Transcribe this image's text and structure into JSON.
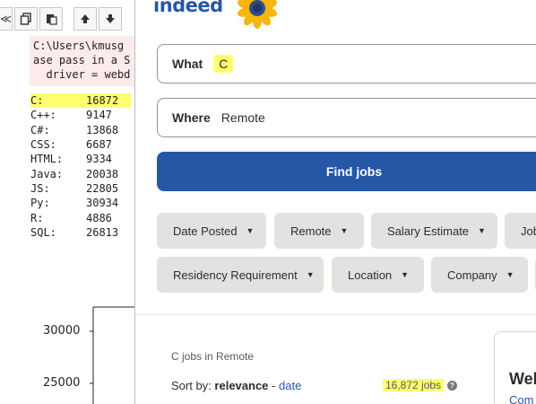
{
  "notebook": {
    "toolbar": {
      "left_partial": "≪",
      "copy_icon": "copy-icon",
      "paste_icon": "paste-icon",
      "up_icon": "arrow-up-icon",
      "down_icon": "arrow-down-icon"
    },
    "stderr_lines": [
      "C:\\Users\\kmusg",
      "ase pass in a S",
      "  driver = webd"
    ],
    "output_rows": [
      {
        "lang": "C:",
        "count": "16872",
        "highlight": true
      },
      {
        "lang": "C++:",
        "count": "9147"
      },
      {
        "lang": "C#:",
        "count": "13868"
      },
      {
        "lang": "CSS:",
        "count": "6687"
      },
      {
        "lang": "HTML:",
        "count": "9334"
      },
      {
        "lang": "Java:",
        "count": "20038"
      },
      {
        "lang": "JS:",
        "count": "22805"
      },
      {
        "lang": "Py:",
        "count": "30934"
      },
      {
        "lang": "R:",
        "count": "4886"
      },
      {
        "lang": "SQL:",
        "count": "26813"
      }
    ],
    "plot_ticks": [
      "30000",
      "25000"
    ]
  },
  "indeed": {
    "logo": "indeed",
    "what_label": "What",
    "what_value": "C",
    "where_label": "Where",
    "where_value": "Remote",
    "find_button": "Find jobs",
    "filters_row1": [
      {
        "label": "Date Posted"
      },
      {
        "label": "Remote"
      },
      {
        "label": "Salary Estimate"
      },
      {
        "label": "Job"
      }
    ],
    "filters_row2": [
      {
        "label": "Residency Requirement"
      },
      {
        "label": "Location"
      },
      {
        "label": "Company"
      }
    ],
    "results_heading": "C jobs in Remote",
    "sort_by_label": "Sort by:",
    "sort_relevance": "relevance",
    "sort_separator": "-",
    "sort_date": "date",
    "job_count": "16,872 jobs",
    "help_glyph": "?",
    "card_title": "Wel",
    "card_link": "Com",
    "colors": {
      "brand_blue": "#2557a7",
      "chip_bg": "#e4e2e0",
      "highlight": "#ffff70"
    }
  }
}
